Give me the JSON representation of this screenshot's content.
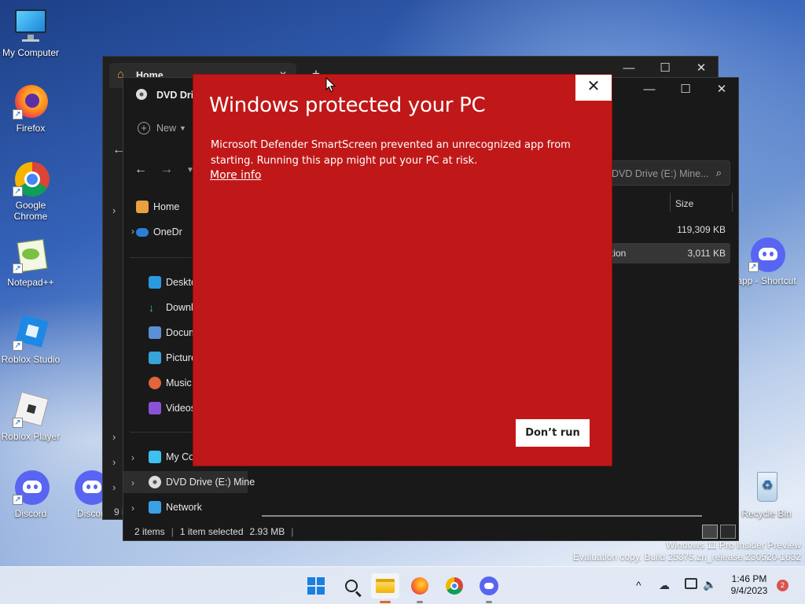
{
  "desktop": {
    "icons": [
      {
        "label": "My Computer",
        "icon": "monitor-icon"
      },
      {
        "label": "Firefox",
        "icon": "firefox-icon"
      },
      {
        "label": "Google Chrome",
        "icon": "chrome-icon"
      },
      {
        "label": "Notepad++",
        "icon": "notepadpp-icon"
      },
      {
        "label": "Roblox Studio",
        "icon": "roblox-studio-icon"
      },
      {
        "label": "Roblox Player",
        "icon": "roblox-player-icon"
      },
      {
        "label": "Discord",
        "icon": "discord-icon"
      },
      {
        "label": "Discor",
        "icon": "discord-icon"
      },
      {
        "label": "app - Shortcut",
        "icon": "discord-icon"
      },
      {
        "label": "Recycle Bin",
        "icon": "recycle-bin-icon"
      }
    ]
  },
  "explorer_back": {
    "tab_title": "Home",
    "new_tab_glyph": "+",
    "controls": {
      "minimize": "—",
      "maximize": "☐",
      "close": "✕"
    }
  },
  "explorer_front": {
    "title": "DVD Drive (E:) Mine...",
    "title_visible": "DVD Driv",
    "new_button": "New",
    "search_placeholder": "DVD Drive (E:) Mine...",
    "column_size": "Size",
    "rows": [
      {
        "name": "",
        "size": "119,309 KB"
      },
      {
        "name": "tion",
        "size": "3,011 KB"
      }
    ],
    "nav": {
      "home": "Home",
      "onedrive": "OneDr",
      "desktop": "Deskto",
      "downloads": "Downl",
      "documents": "Docum",
      "pictures": "Picture",
      "music": "Music",
      "videos": "Videos",
      "mycomputer": "My Co",
      "dvd": "DVD Drive (E:) Mine",
      "network": "Network"
    },
    "status": {
      "items": "2 items",
      "selected": "1 item selected",
      "size": "2.93 MB"
    },
    "back_window_status": "9 i",
    "controls": {
      "minimize": "—",
      "maximize": "☐",
      "close": "✕"
    }
  },
  "dialog": {
    "title": "Windows protected your PC",
    "message": "Microsoft Defender SmartScreen prevented an unrecognized app from starting. Running this app might put your PC at risk.",
    "more_info": "More info",
    "dont_run": "Don’t run",
    "close": "✕",
    "background": "#c01818"
  },
  "watermark": {
    "line1": "Windows 11 Pro Insider Preview",
    "line2": "Evaluation copy. Build 25375.zn_release.230520-1632"
  },
  "taskbar": {
    "apps": [
      "start-icon",
      "search-icon",
      "file-explorer-icon",
      "firefox-icon",
      "chrome-icon",
      "discord-icon"
    ],
    "tray": {
      "chevron": "^",
      "time": "1:46 PM",
      "date": "9/4/2023",
      "notifications": "2"
    }
  }
}
